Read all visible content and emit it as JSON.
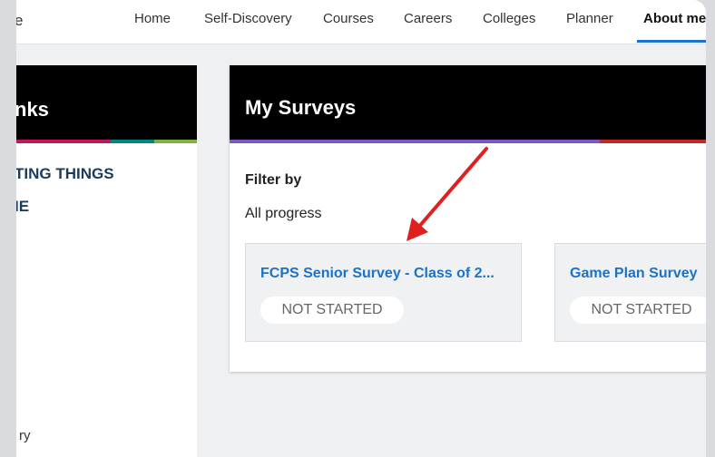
{
  "nav": {
    "brand": "e",
    "items": [
      "Home",
      "Self-Discovery",
      "Courses",
      "Careers",
      "Colleges",
      "Planner",
      "About me"
    ],
    "active_index": 6
  },
  "left_panel": {
    "title": "nks",
    "links": [
      "TING THINGS",
      "IE"
    ],
    "bottom_text": "ry",
    "stripe_colors": [
      "#c2185b",
      "#00897b",
      "#7cb342"
    ]
  },
  "surveys_panel": {
    "title": "My Surveys",
    "stripe_colors": [
      "#7e57c2",
      "#c62828"
    ],
    "filter_label": "Filter by",
    "filter_value": "All progress",
    "cards": [
      {
        "title": "FCPS Senior Survey - Class of 2...",
        "status": "NOT STARTED"
      },
      {
        "title": "Game Plan Survey",
        "status": "NOT STARTED"
      }
    ]
  },
  "annotation": {
    "color": "#e02020"
  }
}
